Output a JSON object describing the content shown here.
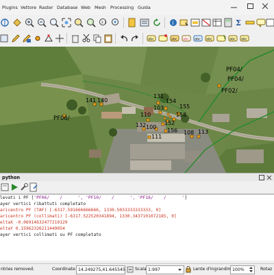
{
  "menu": {
    "items": [
      "Plugins",
      "Vettore",
      "Raster",
      "Database",
      "Web",
      "Mesh",
      "Processing",
      "Guida"
    ]
  },
  "map": {
    "points": [
      "141",
      "140",
      "131",
      "154",
      "103",
      "155",
      "110",
      "158",
      "132",
      "100",
      "152",
      "156",
      "108",
      "113",
      "111"
    ],
    "pf_labels": [
      "PF06/",
      "PF04/",
      "PF04/",
      "PF02/"
    ]
  },
  "python_panel": {
    "title": "python"
  },
  "console": {
    "line1_prefix": "levati i PF [",
    "line1_values": "'PF06/    /      ', 'PF10/    /      ', 'PF16/    /      '",
    "line1_suffix": "]",
    "line2": "ayer vertici ribattuti completato",
    "line3": "aricentro PF (TAF) [-6317.591666666666, 1330.5033333333333, 0]",
    "line4": "aricentro PF (collimati) [-6317.522520341894, 1330.3437101072185, 0]",
    "line5": "eltaX -0.06914632477219129",
    "line6": "eltaY 0.15962326211449054",
    "line7": "ayer vertici collimati su PF completato"
  },
  "status": {
    "left_message": "ntries removed.",
    "coordinate_label": "Coordinate",
    "coordinate_value": "14.249275,41.645545",
    "scale_label": "Scala",
    "scale_value": "1:997",
    "magnifier_label": "Lente d'ingrandimento",
    "magnifier_value": "100%",
    "rotation_label": "Rotaz"
  },
  "colors": {
    "point_fill": "#f2a21b",
    "point_stroke": "#5a3a00",
    "line_color": "#2f8a2f",
    "console_red": "#c8311c"
  }
}
